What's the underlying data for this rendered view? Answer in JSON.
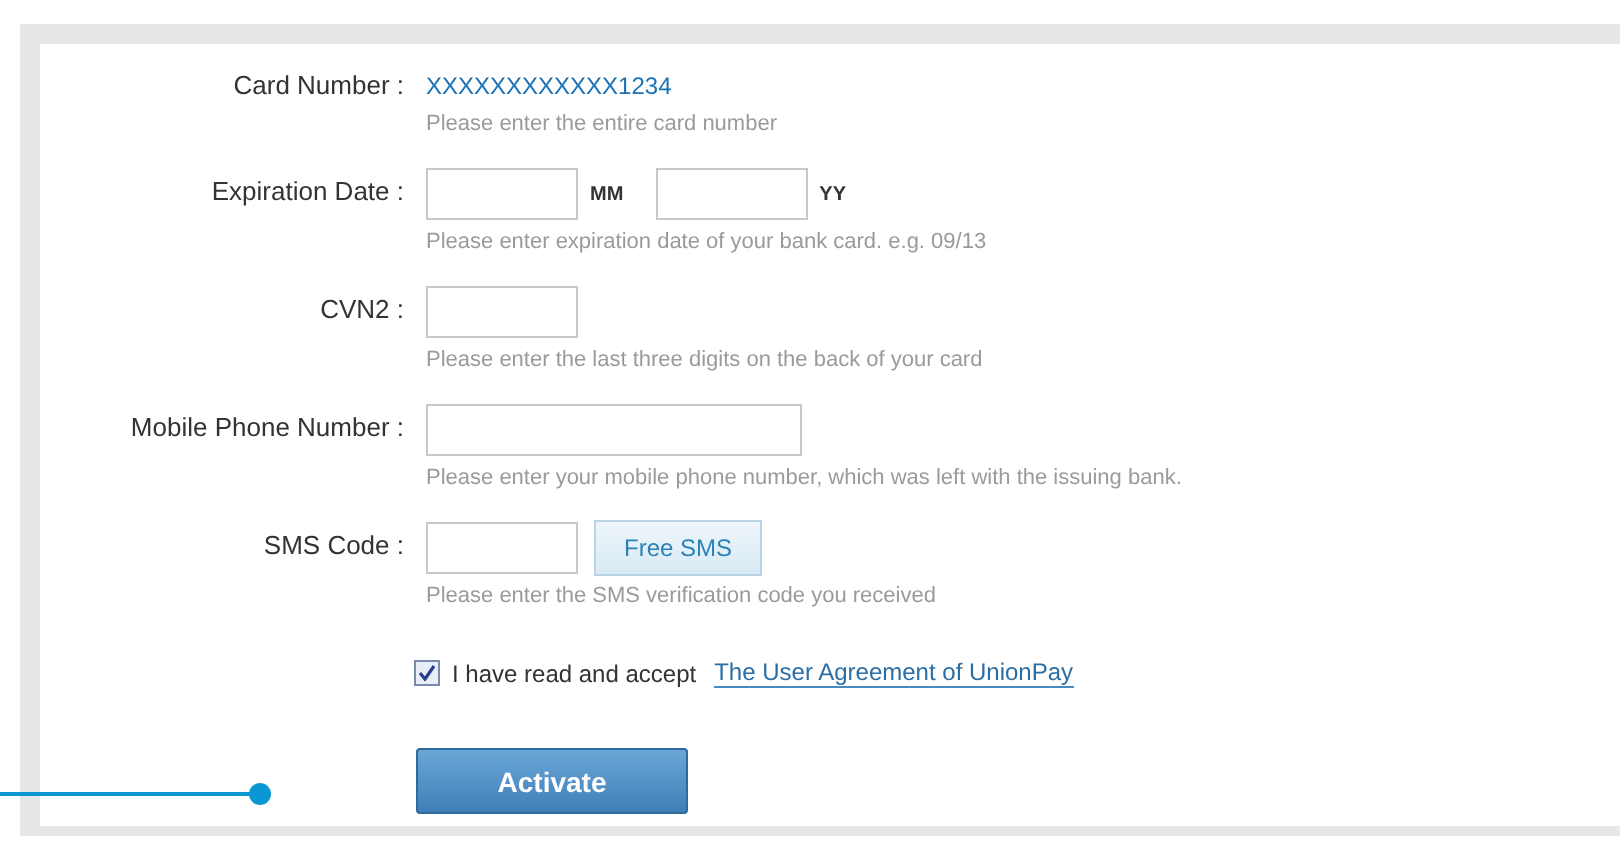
{
  "form": {
    "rows": [
      {
        "kind": "value",
        "label": "Card Number :",
        "value": "XXXXXXXXXXXX1234",
        "hint": "Please enter the entire card number"
      },
      {
        "kind": "date",
        "label": "Expiration Date :",
        "units": [
          "MM",
          "YY"
        ],
        "hint": "Please enter expiration date of your bank card. e.g. 09/13"
      },
      {
        "kind": "short",
        "label": "CVN2 :",
        "hint": "Please enter the last three digits on the back of your card"
      },
      {
        "kind": "long",
        "label": "Mobile Phone Number :",
        "hint": "Please enter your mobile phone number, which was left with the issuing bank."
      },
      {
        "kind": "sms",
        "label": "SMS Code :",
        "button": "Free SMS",
        "hint": "Please enter the SMS verification code you received"
      }
    ],
    "agreement": {
      "checked": true,
      "text": "I have read and accept",
      "link": "The User Agreement of UnionPay"
    },
    "submit": "Activate"
  }
}
